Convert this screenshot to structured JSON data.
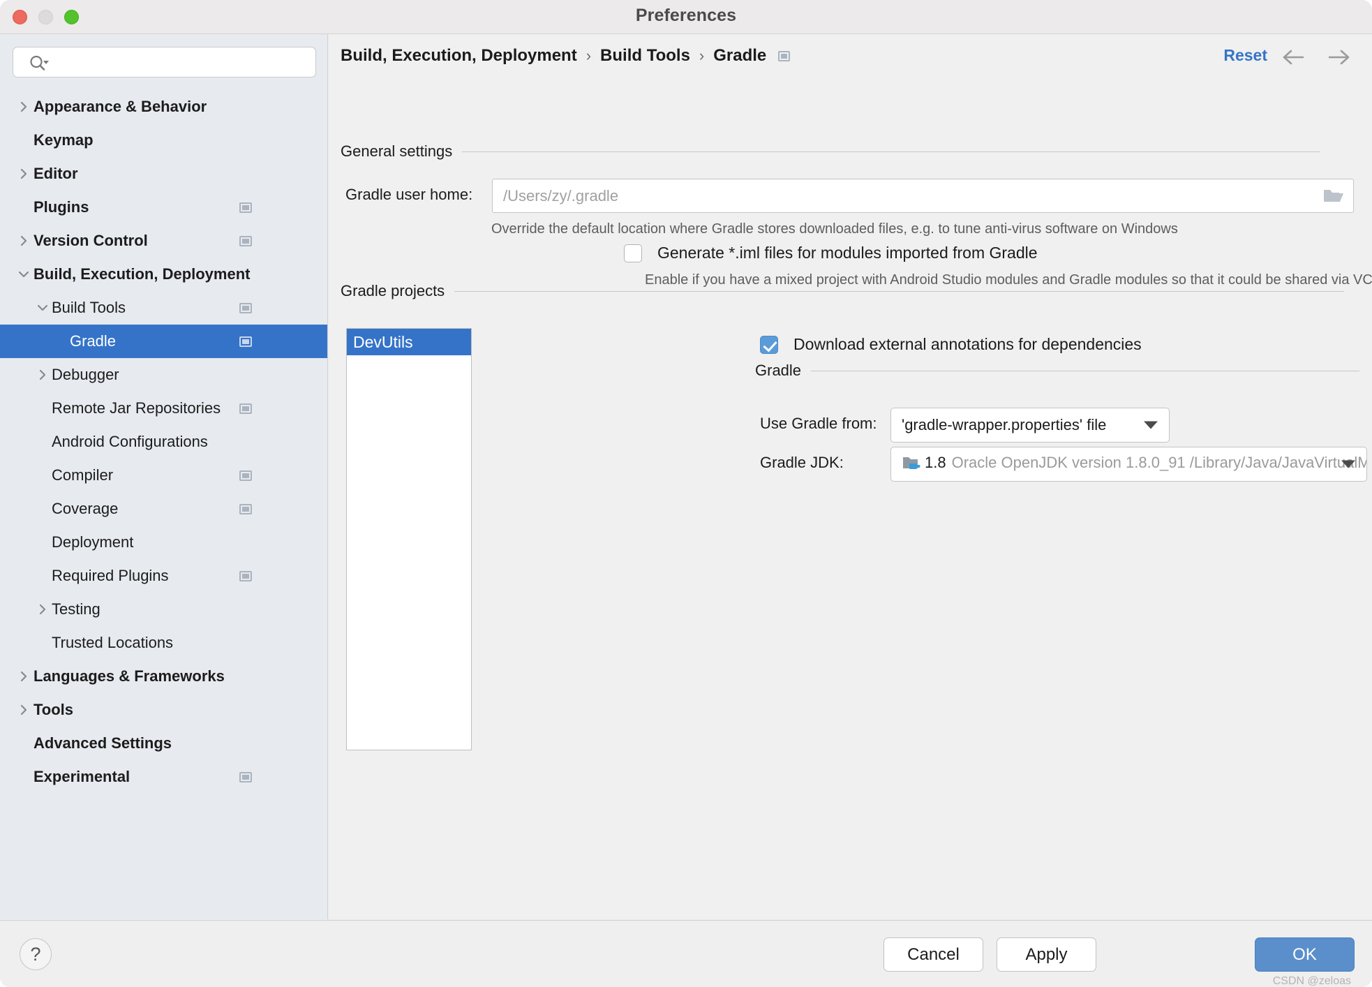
{
  "window": {
    "title": "Preferences",
    "traffic_lights": [
      "close-red",
      "minimize-gray",
      "zoom-green"
    ]
  },
  "sidebar": {
    "search": {
      "placeholder": "",
      "value": "",
      "icon": "search-icon"
    },
    "items": [
      {
        "label": "Appearance & Behavior",
        "depth": 0,
        "arrow": "collapsed",
        "bold": true,
        "badge": false,
        "selected": false
      },
      {
        "label": "Keymap",
        "depth": 0,
        "arrow": "none",
        "bold": true,
        "badge": false,
        "selected": false
      },
      {
        "label": "Editor",
        "depth": 0,
        "arrow": "collapsed",
        "bold": true,
        "badge": false,
        "selected": false
      },
      {
        "label": "Plugins",
        "depth": 0,
        "arrow": "none",
        "bold": true,
        "badge": true,
        "selected": false
      },
      {
        "label": "Version Control",
        "depth": 0,
        "arrow": "collapsed",
        "bold": true,
        "badge": true,
        "selected": false
      },
      {
        "label": "Build, Execution, Deployment",
        "depth": 0,
        "arrow": "expanded",
        "bold": true,
        "badge": false,
        "selected": false
      },
      {
        "label": "Build Tools",
        "depth": 1,
        "arrow": "expanded",
        "bold": false,
        "badge": true,
        "selected": false
      },
      {
        "label": "Gradle",
        "depth": 2,
        "arrow": "none",
        "bold": false,
        "badge": true,
        "selected": true
      },
      {
        "label": "Debugger",
        "depth": 1,
        "arrow": "collapsed",
        "bold": false,
        "badge": false,
        "selected": false
      },
      {
        "label": "Remote Jar Repositories",
        "depth": 1,
        "arrow": "none",
        "bold": false,
        "badge": true,
        "selected": false
      },
      {
        "label": "Android Configurations",
        "depth": 1,
        "arrow": "none",
        "bold": false,
        "badge": false,
        "selected": false
      },
      {
        "label": "Compiler",
        "depth": 1,
        "arrow": "none",
        "bold": false,
        "badge": true,
        "selected": false
      },
      {
        "label": "Coverage",
        "depth": 1,
        "arrow": "none",
        "bold": false,
        "badge": true,
        "selected": false
      },
      {
        "label": "Deployment",
        "depth": 1,
        "arrow": "none",
        "bold": false,
        "badge": false,
        "selected": false
      },
      {
        "label": "Required Plugins",
        "depth": 1,
        "arrow": "none",
        "bold": false,
        "badge": true,
        "selected": false
      },
      {
        "label": "Testing",
        "depth": 1,
        "arrow": "collapsed",
        "bold": false,
        "badge": false,
        "selected": false
      },
      {
        "label": "Trusted Locations",
        "depth": 1,
        "arrow": "none",
        "bold": false,
        "badge": false,
        "selected": false
      },
      {
        "label": "Languages & Frameworks",
        "depth": 0,
        "arrow": "collapsed",
        "bold": true,
        "badge": false,
        "selected": false
      },
      {
        "label": "Tools",
        "depth": 0,
        "arrow": "collapsed",
        "bold": true,
        "badge": false,
        "selected": false
      },
      {
        "label": "Advanced Settings",
        "depth": 0,
        "arrow": "none",
        "bold": true,
        "badge": false,
        "selected": false
      },
      {
        "label": "Experimental",
        "depth": 0,
        "arrow": "none",
        "bold": true,
        "badge": true,
        "selected": false
      }
    ]
  },
  "breadcrumb": {
    "crumbs": [
      "Build, Execution, Deployment",
      "Build Tools",
      "Gradle"
    ],
    "separator": "›",
    "reset_label": "Reset",
    "back_icon": "arrow-left-icon",
    "forward_icon": "arrow-right-icon",
    "scope_badge_icon": "project-scope-icon"
  },
  "general_settings": {
    "section_title": "General settings",
    "gradle_user_home": {
      "label": "Gradle user home:",
      "value": "",
      "placeholder": "/Users/zy/.gradle",
      "browse_icon": "folder-open-icon"
    },
    "gradle_user_home_hint": "Override the default location where Gradle stores downloaded files, e.g. to tune anti-virus software on Windows",
    "generate_iml": {
      "label": "Generate *.iml files for modules imported from Gradle",
      "checked": false
    },
    "generate_iml_hint": "Enable if you have a mixed project with Android Studio modules and Gradle modules so that it could be shared via VCS"
  },
  "gradle_projects": {
    "section_title": "Gradle projects",
    "projects": [
      {
        "name": "DevUtils",
        "selected": true
      }
    ],
    "download_annotations": {
      "label": "Download external annotations for dependencies",
      "checked": true
    },
    "gradle_section": {
      "section_title": "Gradle",
      "use_gradle_from": {
        "label": "Use Gradle from:",
        "value": "'gradle-wrapper.properties' file"
      },
      "gradle_jdk": {
        "label": "Gradle JDK:",
        "icon": "java-sdk-icon",
        "version": "1.8",
        "path": "Oracle OpenJDK version 1.8.0_91 /Library/Java/JavaVirtualM"
      }
    }
  },
  "footer": {
    "help_label": "?",
    "cancel_label": "Cancel",
    "apply_label": "Apply",
    "ok_label": "OK",
    "watermark": "CSDN @zeloas"
  },
  "colors": {
    "selection_blue": "#3573c8",
    "accent_link": "#3574c8",
    "ok_button": "#5b8fcb",
    "sidebar_bg": "#e7eaef",
    "panel_bg": "#f0f0f0"
  }
}
